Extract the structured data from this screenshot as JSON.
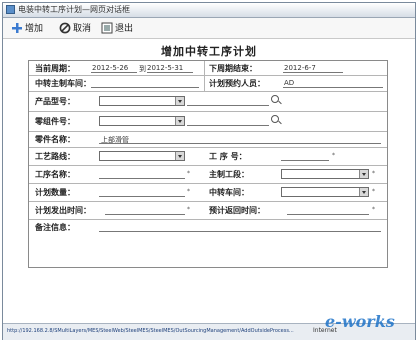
{
  "window": {
    "title": "电装中转工序计划—网页对话框"
  },
  "toolbar": {
    "add_label": "增加",
    "cancel_label": "取消",
    "exit_label": "退出"
  },
  "form": {
    "title": "增加中转工序计划",
    "rows": {
      "plan_period_label": "当前周期：",
      "plan_start": "2012-5-26",
      "to_label": "到",
      "plan_end": "2012-5-31",
      "next_week_label": "下周期结束：",
      "next_week_value": "2012-6-7",
      "workshop_label": "中转主制车间：",
      "planner_label": "计划预约人员：",
      "planner_value": "AD",
      "product_label": "产品型号：",
      "part_label": "零组件号：",
      "part_name_label": "零件名称：",
      "part_name_value": "上部滑管",
      "craft_label": "工艺路线：",
      "op_no_label": "工  序  号：",
      "op_name_label": "工序名称：",
      "main_op_label": "主制工段：",
      "plan_qty_label": "计划数量：",
      "transfer_ws_label": "中转车间：",
      "plan_send_label": "计划发出时间：",
      "return_time_label": "预计返回时间：",
      "remark_label": "备注信息："
    }
  },
  "status": {
    "url": "http://192.168.2.8/SMultiLayers/MES/SteelWeb/SteelMES/SteelMES/OutSourcingManagement/AddOutsideProcess...",
    "zone": "Internet",
    "watermark": "e-works"
  }
}
